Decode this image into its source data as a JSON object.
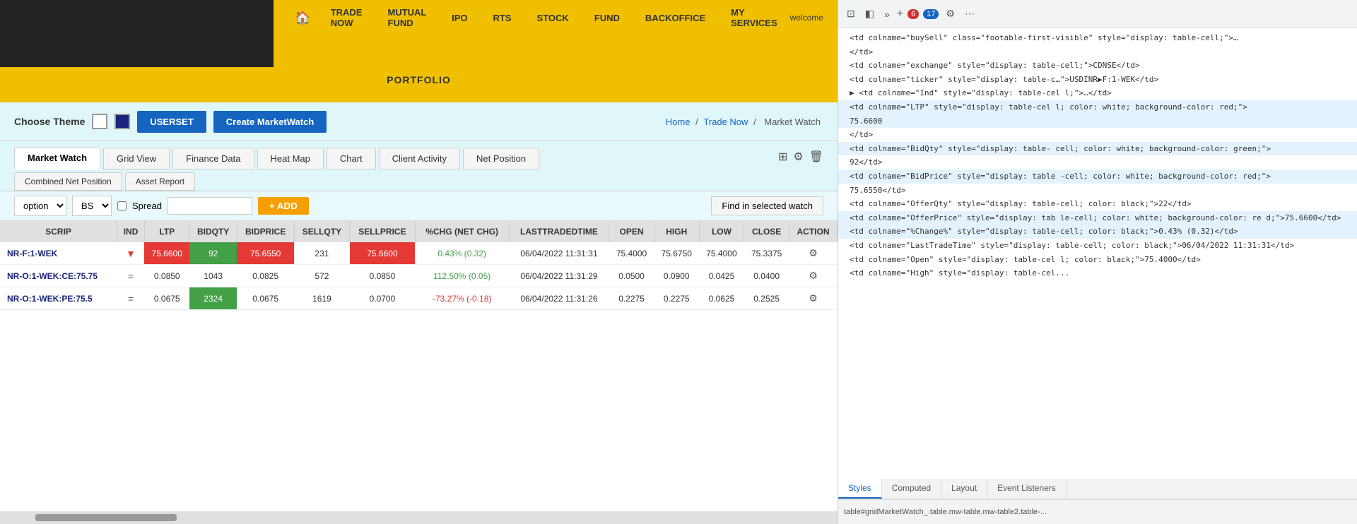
{
  "header": {
    "nav_items": [
      "TRADE NOW",
      "MUTUAL FUND",
      "IPO",
      "RTS",
      "STOCK",
      "FUND",
      "BACKOFFICE",
      "MY SERVICES"
    ],
    "welcome_text": "welcome",
    "portfolio_label": "PORTFOLIO"
  },
  "theme_bar": {
    "choose_theme_label": "Choose Theme",
    "userset_label": "USERSET",
    "create_mw_label": "Create MarketWatch",
    "breadcrumb": {
      "home": "Home",
      "trade_now": "Trade Now",
      "market_watch": "Market Watch"
    }
  },
  "tabs": {
    "row1": [
      "Market Watch",
      "Grid View",
      "Finance Data",
      "Heat Map",
      "Chart",
      "Client Activity",
      "Net Position"
    ],
    "row2": [
      "Combined Net Position",
      "Asset Report"
    ],
    "active_tab": "Market Watch"
  },
  "controls": {
    "option_label": "option",
    "bs_label": "BS",
    "spread_label": "Spread",
    "add_label": "+ ADD",
    "find_label": "Find in selected watch"
  },
  "table": {
    "headers": [
      "SCRIP",
      "IND",
      "LTP",
      "BIDQTY",
      "BIDPRICE",
      "SELLQTY",
      "SELLPRICE",
      "%CHG (NET CHG)",
      "LASTTRADEDTIME",
      "OPEN",
      "HIGH",
      "LOW",
      "CLOSE",
      "ACTION"
    ],
    "rows": [
      {
        "scrip": "NR-F:1-WEK",
        "ind": "▼",
        "ind_type": "down",
        "ltp": "75.6600",
        "ltp_type": "red",
        "bidqty": "92",
        "bidqty_type": "green",
        "bidprice": "75.6550",
        "bidprice_type": "red",
        "sellqty": "231",
        "sellprice": "75.6600",
        "sellprice_type": "red",
        "pct_chg": "0.43% (0.32)",
        "pct_type": "positive",
        "last_trade": "06/04/2022 11:31:31",
        "open": "75.4000",
        "high": "75.6750",
        "low": "75.4000",
        "close": "75.3375"
      },
      {
        "scrip": "NR-O:1-WEK:CE:75.75",
        "ind": "=",
        "ind_type": "eq",
        "ltp": "0.0850",
        "ltp_type": "normal",
        "bidqty": "1043",
        "bidqty_type": "normal",
        "bidprice": "0.0825",
        "bidprice_type": "normal",
        "sellqty": "572",
        "sellprice": "0.0850",
        "sellprice_type": "normal",
        "pct_chg": "112.50% (0.05)",
        "pct_type": "positive",
        "last_trade": "06/04/2022 11:31:29",
        "open": "0.0500",
        "high": "0.0900",
        "low": "0.0425",
        "close": "0.0400"
      },
      {
        "scrip": "NR-O:1-WEK:PE:75.5",
        "ind": "=",
        "ind_type": "eq",
        "ltp": "0.0675",
        "ltp_type": "normal",
        "bidqty": "2324",
        "bidqty_type": "green",
        "bidprice": "0.0675",
        "bidprice_type": "normal",
        "sellqty": "1619",
        "sellprice": "0.0700",
        "sellprice_type": "normal",
        "pct_chg": "-73.27% (-0.18)",
        "pct_type": "negative",
        "last_trade": "06/04/2022 11:31:26",
        "open": "0.2275",
        "high": "0.2275",
        "low": "0.0625",
        "close": "0.2525"
      }
    ]
  },
  "devtools": {
    "badge_red_count": "6",
    "badge_blue_count": "17",
    "tabs": [
      "Styles",
      "Computed",
      "Layout",
      "Event Listeners"
    ],
    "bottom_path": "table#gridMarketWatch_.table.mw-table.mw-table2.table-...",
    "code_lines": [
      "<td colname=\"buySell\" class=\"footable-first-visible\" style=\"display: table-cell;\">…",
      "</td>",
      "<td colname=\"exchange\" style=\"display: table-cell;\">CDNSE</td>",
      "<td colname=\"ticker\" style=\"display: table-c…\">USDINR▶F:1-WEK</td>",
      "▶ <td colname=\"Ind\" style=\"display: table-cel l;\">…</td>",
      "<td colname=\"LTP\" style=\"display: table-cel l; color: white; background-color: red;\">",
      "75.6600",
      "</td>",
      "<td colname=\"BidQty\" style=\"display: table- cell; color: white; background-color: green;\">",
      "92</td>",
      "<td colname=\"BidPrice\" style=\"display: table -cell; color: white; background-color: red;\">",
      "75.6550</td>",
      "<td colname=\"OfferQty\" style=\"display: table-cell; color: black;\">22</td>",
      "<td colname=\"OfferPrice\" style=\"display: tab le-cell; color: white; background-color: re d;\">75.6600</td>",
      "<td colname=\"%Change%\" style=\"display: table-cell; color: black;\">0.43% (0.32)</td>",
      "<td colname=\"LastTradeTime\" style=\"display: table-cell; color: black;\">06/04/2022 11:31:31</td>",
      "<td colname=\"Open\" style=\"display: table-cel l; color: black;\">75.4000</td>",
      "<td colname=\"High\" style=\"display: table-cel..."
    ]
  }
}
